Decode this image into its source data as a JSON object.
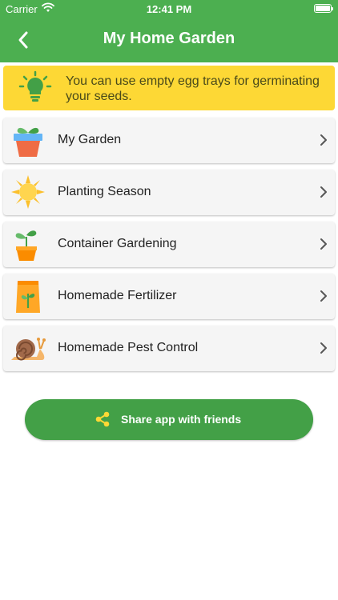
{
  "status_bar": {
    "carrier": "Carrier",
    "time": "12:41 PM"
  },
  "nav": {
    "title": "My Home Garden"
  },
  "tip": {
    "text": "You can use empty egg trays for germinating your seeds."
  },
  "menu": {
    "items": [
      {
        "label": "My Garden",
        "icon": "flower-pot-icon"
      },
      {
        "label": "Planting Season",
        "icon": "sun-icon"
      },
      {
        "label": "Container Gardening",
        "icon": "sprout-icon"
      },
      {
        "label": "Homemade Fertilizer",
        "icon": "fertilizer-bag-icon"
      },
      {
        "label": "Homemade Pest Control",
        "icon": "snail-icon"
      }
    ]
  },
  "share": {
    "label": "Share app with friends"
  },
  "colors": {
    "primary": "#4caf50",
    "share_button": "#43a047",
    "tip_background": "#fdd835",
    "item_background": "#f5f5f5"
  }
}
